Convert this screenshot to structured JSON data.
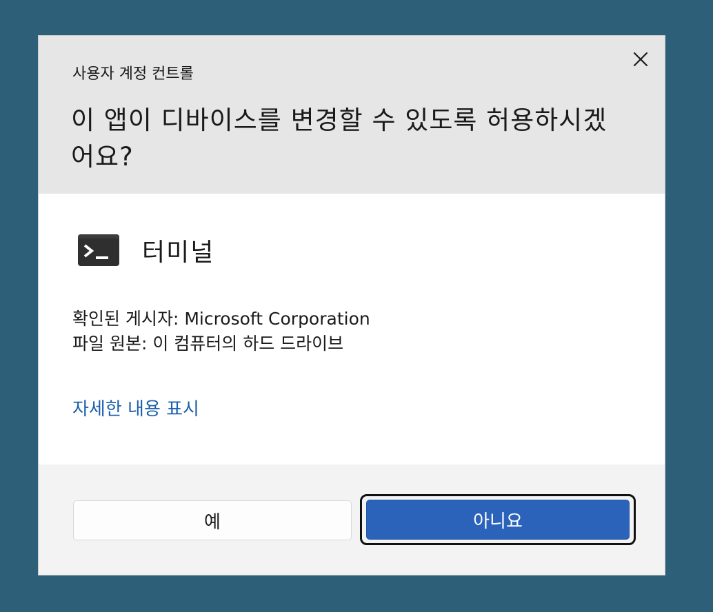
{
  "dialog": {
    "caption": "사용자 계정 컨트롤",
    "question": "이 앱이 디바이스를 변경할 수 있도록 허용하시겠어요?",
    "close_icon": "close-icon"
  },
  "app": {
    "name": "터미널",
    "icon": "terminal-icon"
  },
  "info": {
    "publisher": "확인된 게시자: Microsoft Corporation",
    "origin": "파일 원본: 이 컴퓨터의 하드 드라이브"
  },
  "details_link": "자세한 내용 표시",
  "buttons": {
    "yes": "예",
    "no": "아니요"
  },
  "colors": {
    "background": "#2e5f79",
    "header": "#e6e6e6",
    "link": "#1b5fab",
    "primary_button": "#2b63bb"
  }
}
